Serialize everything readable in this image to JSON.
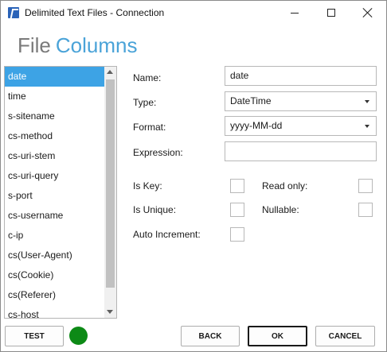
{
  "window": {
    "title": "Delimited Text Files - Connection",
    "icon": "app-icon",
    "controls": [
      "minimize-icon",
      "maximize-icon",
      "close-icon"
    ]
  },
  "heading": {
    "word1": "File",
    "word2": "Columns"
  },
  "columns": {
    "selected": "date",
    "items": [
      {
        "label": "date"
      },
      {
        "label": "time"
      },
      {
        "label": "s-sitename"
      },
      {
        "label": "cs-method"
      },
      {
        "label": "cs-uri-stem"
      },
      {
        "label": "cs-uri-query"
      },
      {
        "label": "s-port"
      },
      {
        "label": "cs-username"
      },
      {
        "label": "c-ip"
      },
      {
        "label": "cs(User-Agent)"
      },
      {
        "label": "cs(Cookie)"
      },
      {
        "label": "cs(Referer)"
      },
      {
        "label": "cs-host"
      }
    ]
  },
  "form": {
    "name_label": "Name:",
    "name_value": "date",
    "type_label": "Type:",
    "type_value": "DateTime",
    "format_label": "Format:",
    "format_value": "yyyy-MM-dd",
    "expression_label": "Expression:",
    "expression_value": "",
    "is_key_label": "Is Key:",
    "is_key_checked": false,
    "read_only_label": "Read only:",
    "read_only_checked": false,
    "is_unique_label": "Is Unique:",
    "is_unique_checked": false,
    "nullable_label": "Nullable:",
    "nullable_checked": false,
    "auto_increment_label": "Auto Increment:",
    "auto_increment_checked": false
  },
  "footer": {
    "test_label": "TEST",
    "status_color": "#0d8a16",
    "back_label": "BACK",
    "ok_label": "OK",
    "cancel_label": "CANCEL"
  },
  "colors": {
    "accent": "#4aa3d8",
    "selection": "#3da3e5"
  }
}
